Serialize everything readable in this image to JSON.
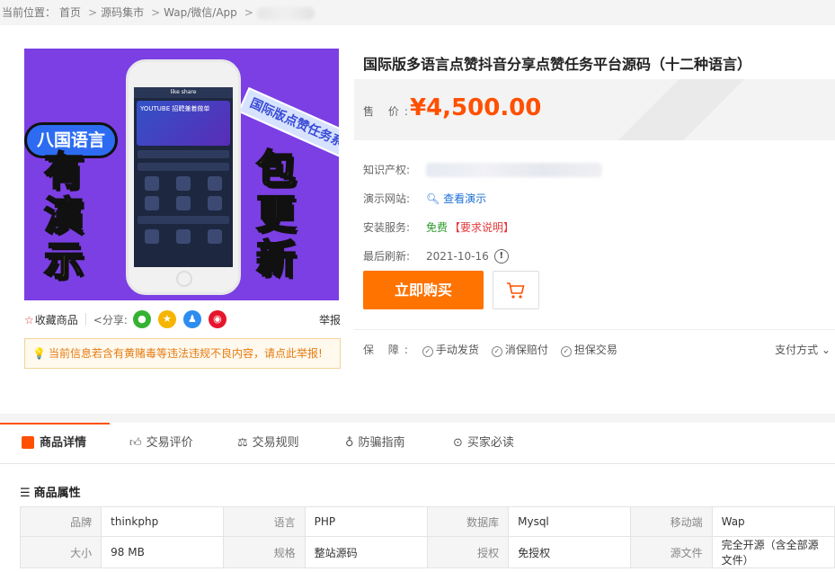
{
  "breadcrumb": {
    "prefix": "当前位置：",
    "items": [
      "首页",
      "源码集市",
      "Wap/微信/App"
    ]
  },
  "gallery": {
    "left_badge": "八国语言",
    "left_big": "有演示",
    "right_big": "包更新",
    "ribbon": "国际版点赞任务系",
    "app_name": "like share",
    "banner_text": "YOUTUBE 招聘兼着做单"
  },
  "share": {
    "favorite": "收藏商品",
    "share_label": "分享:",
    "report": "举报"
  },
  "warning": "当前信息若含有黄赌毒等违法违规不良内容，请点此举报!",
  "product": {
    "title": "国际版多语言点赞抖音分享点赞任务平台源码（十二种语言）",
    "price_label": "售 价:",
    "price": "¥4,500.00"
  },
  "attrs": {
    "ip_label": "知识产权:",
    "demo_label": "演示网站:",
    "demo_link": "查看演示",
    "install_label": "安装服务:",
    "install_value": "免费",
    "install_note": "【要求说明】",
    "refresh_label": "最后刷新:",
    "refresh_value": "2021-10-16"
  },
  "buttons": {
    "buy": "立即购买"
  },
  "guarantee": {
    "label": "保 障:",
    "items": [
      "手动发货",
      "消保赔付",
      "担保交易"
    ],
    "pay": "支付方式"
  },
  "tabs": [
    "商品详情",
    "交易评价",
    "交易规则",
    "防骗指南",
    "买家必读"
  ],
  "props": {
    "title": "商品属性",
    "rows": [
      [
        [
          "品牌",
          "thinkphp"
        ],
        [
          "语言",
          "PHP"
        ],
        [
          "数据库",
          "Mysql"
        ],
        [
          "移动端",
          "Wap"
        ]
      ],
      [
        [
          "大小",
          "98 MB"
        ],
        [
          "规格",
          "整站源码"
        ],
        [
          "授权",
          "免授权"
        ],
        [
          "源文件",
          "完全开源（含全部源文件）"
        ]
      ]
    ]
  },
  "colors": {
    "accent": "#ff5000",
    "buy_button": "#ff7300",
    "link": "#1e70d4",
    "free": "#2c9b2c",
    "gallery_bg": "#7b3fe4"
  }
}
